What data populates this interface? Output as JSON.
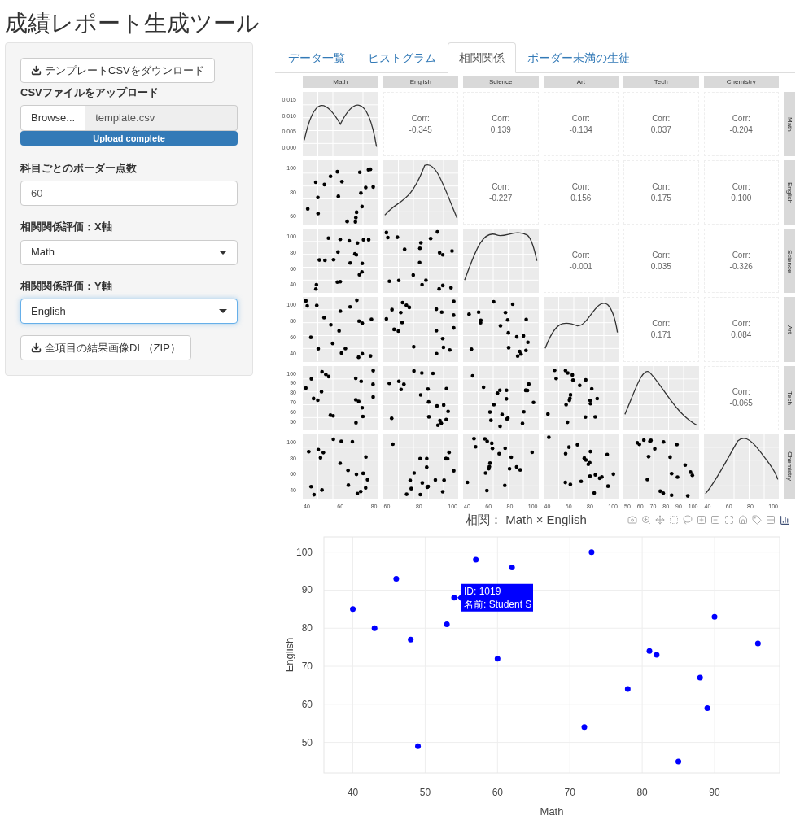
{
  "title": "成績レポート生成ツール",
  "sidebar": {
    "template_button": "テンプレートCSVをダウンロード",
    "upload": {
      "label": "CSVファイルをアップロード",
      "browse": "Browse...",
      "file": "template.csv",
      "progress": {
        "level": 1,
        "text": "Upload complete"
      }
    },
    "border": {
      "label": "科目ごとのボーダー点数",
      "value": "60"
    },
    "x_axis": {
      "label": "相関関係評価：X軸",
      "value": "Math",
      "focused": false
    },
    "y_axis": {
      "label": "相関関係評価：Y軸",
      "value": "English",
      "focused": true
    },
    "zip_button": "全項目の結果画像DL（ZIP）"
  },
  "tabs": [
    {
      "label": "データ一覧",
      "selected": false
    },
    {
      "label": "ヒストグラム",
      "selected": false
    },
    {
      "label": "相関関係",
      "selected": true
    },
    {
      "label": "ボーダー未満の生徒",
      "selected": false
    }
  ],
  "pairs_plot": {
    "column_strips": [
      "Math",
      "English",
      "Science",
      "Art",
      "Tech",
      "Chemistry"
    ],
    "row_strips": [
      "Math",
      "English",
      "Science",
      "Art",
      "Tech",
      "Chemistry"
    ],
    "rows": [
      [
        {
          "kind": "density"
        },
        {
          "kind": "corr",
          "label": "Corr:",
          "value": "-0.345"
        },
        {
          "kind": "corr",
          "label": "Corr:",
          "value": "0.139"
        },
        {
          "kind": "corr",
          "label": "Corr:",
          "value": "-0.134"
        },
        {
          "kind": "corr",
          "label": "Corr:",
          "value": "0.037"
        },
        {
          "kind": "corr",
          "label": "Corr:",
          "value": "-0.204"
        }
      ],
      [
        {
          "kind": "scatter"
        },
        {
          "kind": "density"
        },
        {
          "kind": "corr",
          "label": "Corr:",
          "value": "-0.227"
        },
        {
          "kind": "corr",
          "label": "Corr:",
          "value": "0.156"
        },
        {
          "kind": "corr",
          "label": "Corr:",
          "value": "0.175"
        },
        {
          "kind": "corr",
          "label": "Corr:",
          "value": "0.100"
        }
      ],
      [
        {
          "kind": "scatter"
        },
        {
          "kind": "scatter"
        },
        {
          "kind": "density"
        },
        {
          "kind": "corr",
          "label": "Corr:",
          "value": "-0.001"
        },
        {
          "kind": "corr",
          "label": "Corr:",
          "value": "0.035"
        },
        {
          "kind": "corr",
          "label": "Corr:",
          "value": "-0.326"
        }
      ],
      [
        {
          "kind": "scatter"
        },
        {
          "kind": "scatter"
        },
        {
          "kind": "scatter"
        },
        {
          "kind": "density"
        },
        {
          "kind": "corr",
          "label": "Corr:",
          "value": "0.171"
        },
        {
          "kind": "corr",
          "label": "Corr:",
          "value": "0.084"
        }
      ],
      [
        {
          "kind": "scatter"
        },
        {
          "kind": "scatter"
        },
        {
          "kind": "scatter"
        },
        {
          "kind": "scatter"
        },
        {
          "kind": "density"
        },
        {
          "kind": "corr",
          "label": "Corr:",
          "value": "-0.065"
        }
      ],
      [
        {
          "kind": "scatter"
        },
        {
          "kind": "scatter"
        },
        {
          "kind": "scatter"
        },
        {
          "kind": "scatter"
        },
        {
          "kind": "scatter"
        },
        {
          "kind": "density"
        }
      ]
    ],
    "row_ticks": [
      [
        "0.015",
        "0.010",
        "0.005",
        "0.000"
      ],
      [
        "100",
        "80",
        "60"
      ],
      [
        "100",
        "80",
        "60",
        "40"
      ],
      [
        "100",
        "80",
        "60",
        "40"
      ],
      [
        "100",
        "90",
        "80",
        "70",
        "60",
        "50"
      ],
      [
        "100",
        "80",
        "60",
        "40"
      ]
    ],
    "column_ticks": [
      [
        "40",
        "60",
        "80"
      ],
      [
        "60",
        "80",
        "100"
      ],
      [
        "40",
        "60",
        "80",
        "100"
      ],
      [
        "40",
        "60",
        "80",
        "100"
      ],
      [
        "50",
        "60",
        "70",
        "80",
        "90",
        "100"
      ],
      [
        "40",
        "60",
        "80",
        "100"
      ]
    ]
  },
  "scatter": {
    "title": "相関： Math × English",
    "tooltip": {
      "lines": [
        "ID: 1019",
        "名前: Student S"
      ]
    },
    "chart_data": {
      "type": "scatter",
      "xlabel": "Math",
      "ylabel": "English",
      "grid": true,
      "x": [
        40,
        43,
        46,
        48,
        49,
        53,
        54,
        57,
        60,
        62,
        72,
        73,
        78,
        81,
        82,
        85,
        88,
        89,
        90,
        96
      ],
      "series": [
        {
          "color": "#0000ff",
          "values": [
            85,
            80,
            93,
            77,
            49,
            81,
            88,
            98,
            72,
            96,
            54,
            100,
            64,
            74,
            73,
            45,
            67,
            59,
            83,
            76
          ]
        }
      ],
      "xlim": [
        36,
        99
      ],
      "ylim": [
        42,
        104
      ],
      "xticks": [
        40,
        50,
        60,
        70,
        80,
        90
      ],
      "yticks": [
        50,
        60,
        70,
        80,
        90,
        100
      ]
    }
  }
}
